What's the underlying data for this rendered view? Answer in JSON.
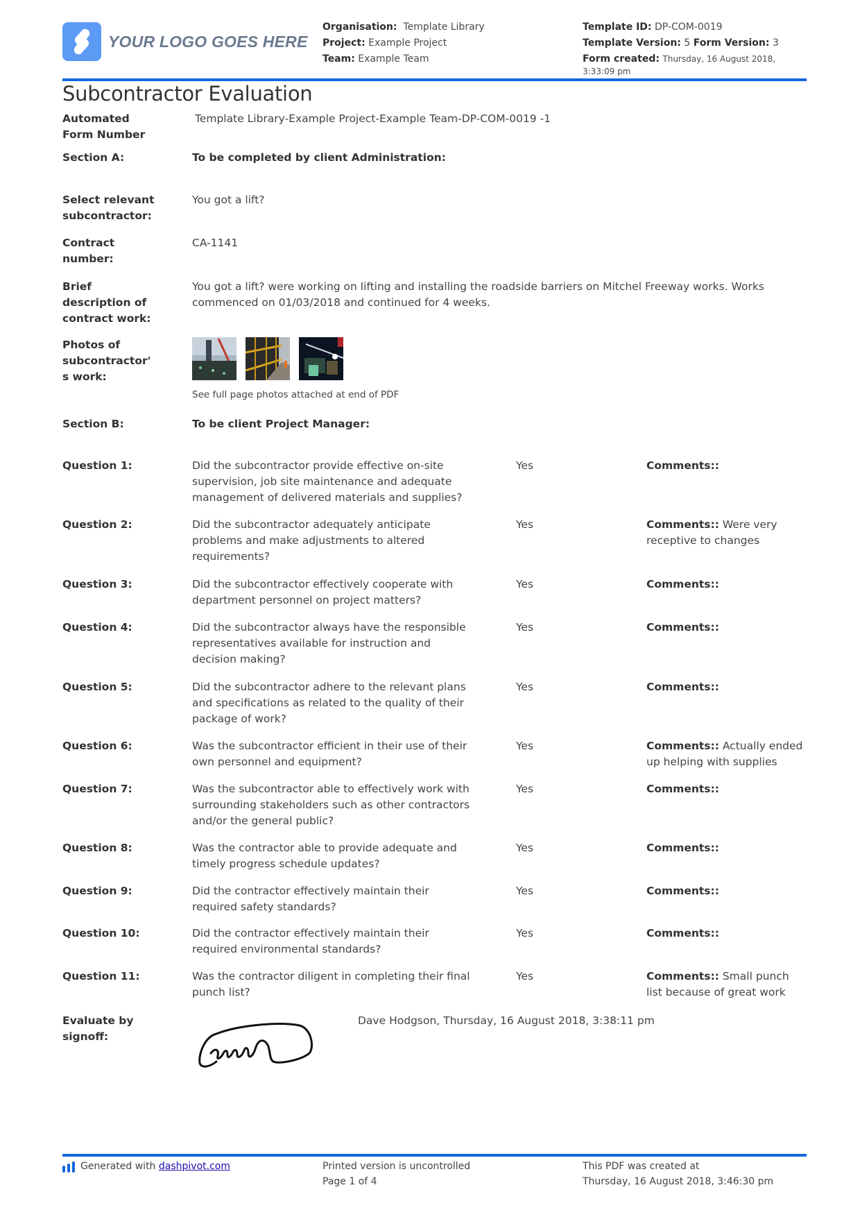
{
  "header": {
    "logo_text": "YOUR LOGO GOES HERE",
    "organisation_label": "Organisation:",
    "organisation_value": "Template Library",
    "project_label": "Project:",
    "project_value": "Example Project",
    "team_label": "Team:",
    "team_value": "Example Team",
    "template_id_label": "Template ID:",
    "template_id_value": "DP-COM-0019",
    "template_version_label": "Template Version:",
    "template_version_value": "5",
    "form_version_label": "Form Version:",
    "form_version_value": "3",
    "form_created_label": "Form created:",
    "form_created_value": "Thursday, 16 August 2018, 3:33:09 pm",
    "accent_color": "#1565e0"
  },
  "title": "Subcontractor Evaluation",
  "form_number": {
    "label": "Automated Form Number",
    "value": "Template Library-Example Project-Example Team-DP-COM-0019   -1"
  },
  "section_a": {
    "label": "Section A:",
    "value": "To be completed by client Administration:"
  },
  "subcontractor": {
    "label": "Select relevant subcontractor:",
    "value": "You got a lift?"
  },
  "contract_number": {
    "label": "Contract number:",
    "value": "CA-1141"
  },
  "description": {
    "label": "Brief description of contract work:",
    "value": "You got a lift? were working on lifting and installing the roadside barriers on Mitchel Freeway works. Works commenced on 01/03/2018 and continued for 4 weeks."
  },
  "photos": {
    "label": "Photos of subcontractor' s work:",
    "items": [
      "crane-site-photo",
      "barrier-wall-photo",
      "night-works-photo"
    ],
    "caption": "See full page photos attached at end of PDF"
  },
  "section_b": {
    "label": "Section B:",
    "value": "To be client Project Manager:"
  },
  "questions": [
    {
      "label": "Question 1:",
      "text": "Did the subcontractor provide effective on-site supervision, job site maintenance and adequate management of delivered materials and supplies?",
      "answer": "Yes",
      "comment_label": "Comments::",
      "comment": ""
    },
    {
      "label": "Question 2:",
      "text": "Did the subcontractor adequately anticipate problems and make adjustments to altered requirements?",
      "answer": "Yes",
      "comment_label": "Comments::",
      "comment": "Were very receptive to changes"
    },
    {
      "label": "Question 3:",
      "text": "Did the subcontractor effectively cooperate with department personnel on project matters?",
      "answer": "Yes",
      "comment_label": "Comments::",
      "comment": ""
    },
    {
      "label": "Question 4:",
      "text": "Did the subcontractor always have the responsible representatives available for instruction and decision making?",
      "answer": "Yes",
      "comment_label": "Comments::",
      "comment": ""
    },
    {
      "label": "Question 5:",
      "text": "Did the subcontractor adhere to the relevant plans and specifications as related to the quality of their package of work?",
      "answer": "Yes",
      "comment_label": "Comments::",
      "comment": ""
    },
    {
      "label": "Question 6:",
      "text": "Was the subcontractor efficient in their use of their own personnel and equipment?",
      "answer": "Yes",
      "comment_label": "Comments::",
      "comment": "Actually ended up helping with supplies"
    },
    {
      "label": "Question 7:",
      "text": "Was the subcontractor able to effectively work with surrounding stakeholders such as other contractors and/or the general public?",
      "answer": "Yes",
      "comment_label": "Comments::",
      "comment": ""
    },
    {
      "label": "Question 8:",
      "text": "Was the contractor able to provide adequate and timely progress schedule updates?",
      "answer": "Yes",
      "comment_label": "Comments::",
      "comment": ""
    },
    {
      "label": "Question 9:",
      "text": "Did the contractor effectively maintain their required safety standards?",
      "answer": "Yes",
      "comment_label": "Comments::",
      "comment": ""
    },
    {
      "label": "Question 10:",
      "text": "Did the contractor effectively maintain their required environmental standards?",
      "answer": "Yes",
      "comment_label": "Comments::",
      "comment": ""
    },
    {
      "label": "Question 11:",
      "text": "Was the contractor diligent in completing their final punch list?",
      "answer": "Yes",
      "comment_label": "Comments::",
      "comment": "Small punch list because of great work"
    }
  ],
  "signoff": {
    "label": "Evaluate by signoff:",
    "value": "Dave Hodgson, Thursday, 16 August 2018, 3:38:11 pm"
  },
  "footer": {
    "generated_text": "Generated with",
    "generated_link": "dashpivot.com",
    "printed_notice": "Printed version is uncontrolled",
    "page_info": "Page 1 of 4",
    "pdf_created_label": "This PDF was created at",
    "pdf_created_value": "Thursday, 16 August 2018, 3:46:30 pm"
  }
}
